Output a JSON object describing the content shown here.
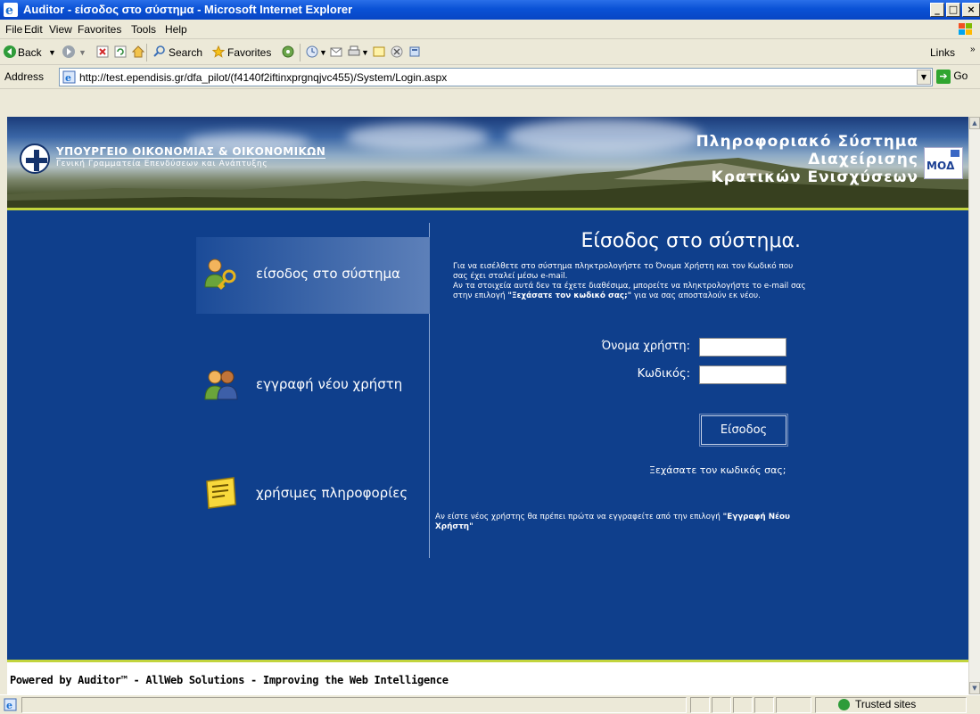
{
  "window": {
    "title": "Auditor - είσοδος στο σύστημα - Microsoft Internet Explorer",
    "controls": [
      "minimize",
      "maximize",
      "close"
    ]
  },
  "menu": [
    "File",
    "Edit",
    "View",
    "Favorites",
    "Tools",
    "Help"
  ],
  "toolbar": {
    "back": "Back",
    "search": "Search",
    "favorites": "Favorites",
    "links": "Links"
  },
  "address": {
    "label": "Address",
    "url": "http://test.ependisis.gr/dfa_pilot/(f4140f2iftinxprgnqjvc455)/System/Login.aspx",
    "go": "Go"
  },
  "banner": {
    "ministry": "ΥΠΟΥΡΓΕΙΟ ΟΙΚΟΝΟΜΙΑΣ & ΟΙΚΟΝΟΜΙΚΩΝ",
    "ministry_sub": "Γενική Γραμματεία Επενδύσεων και Ανάπτυξης",
    "system_line1": "Πληροφοριακό Σύστημα",
    "system_line2": "Διαχείρισης",
    "system_line3": "Κρατικών Ενισχύσεων",
    "logo": "ΜΟΔ"
  },
  "nav": [
    {
      "label": "είσοδος στο σύστημα",
      "icon": "user-key-icon",
      "active": true
    },
    {
      "label": "εγγραφή νέου χρήστη",
      "icon": "users-icon",
      "active": false
    },
    {
      "label": "χρήσιμες πληροφορίες",
      "icon": "note-icon",
      "active": false
    }
  ],
  "login": {
    "heading": "Είσοδος στο σύστημα.",
    "intro_1": "Για να εισέλθετε στο σύστημα πληκτρολογήστε το Όνομα Χρήστη και τον Κωδικό που σας έχει σταλεί μέσω e-mail.",
    "intro_2": "Αν τα στοιχεία αυτά δεν τα έχετε διαθέσιμα, μπορείτε να πληκτρολογήστε το e-mail σας στην επιλογή",
    "intro_link": "\"Ξεχάσατε τον κωδικό σας;\"",
    "intro_3": "για να σας αποσταλούν εκ νέου.",
    "username_label": "Όνομα χρήστη:",
    "username_value": "",
    "password_label": "Κωδικός:",
    "password_value": "",
    "submit": "Είσοδος",
    "forgot": "Ξεχάσατε τον κωδικός σας;",
    "new_user_1": "Αν είστε νέος χρήστης θα πρέπει πρώτα να εγγραφείτε από την επιλογή",
    "new_user_link": "\"Εγγραφή Νέου Χρήστη\""
  },
  "footer": "Powered by Auditor™ - AllWeb Solutions - Improving the Web Intelligence",
  "status": {
    "zone": "Trusted sites"
  },
  "colors": {
    "page_blue": "#0f3f8c",
    "accent_green": "#c2d43d",
    "titlebar": "#0a52d6"
  }
}
